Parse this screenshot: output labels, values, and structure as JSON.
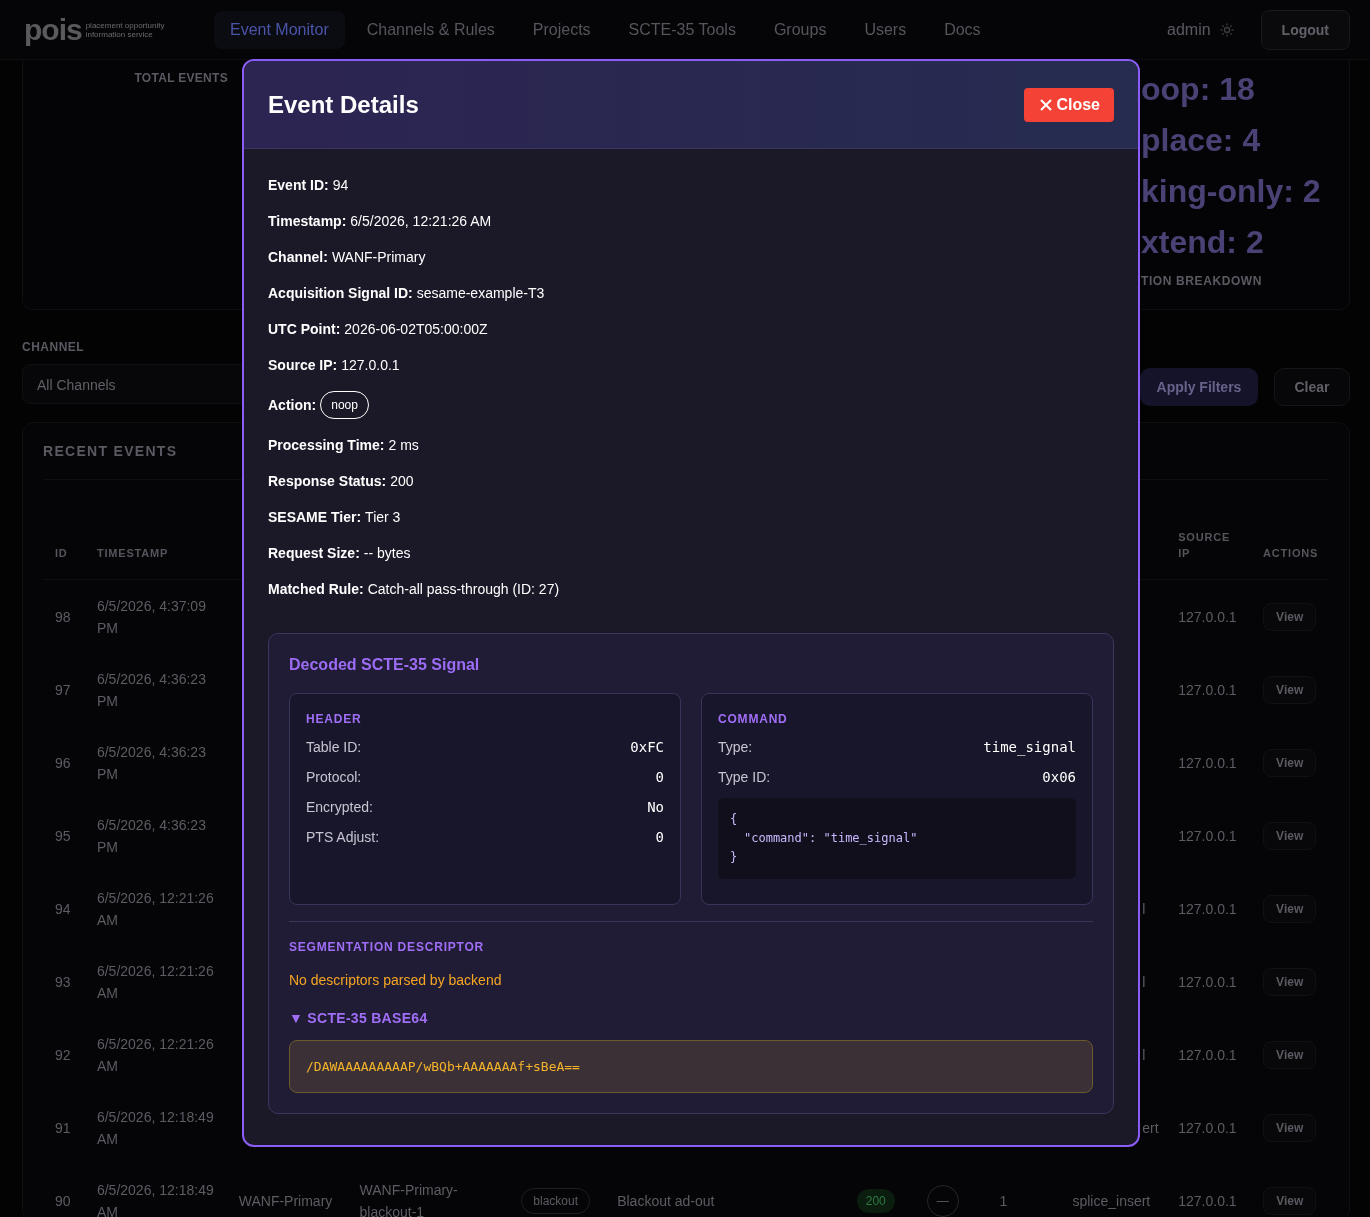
{
  "nav": {
    "logo": "pois",
    "tagline": "placement opportunity information service",
    "links": [
      {
        "label": "Event Monitor",
        "selected": true
      },
      {
        "label": "Channels & Rules",
        "selected": false
      },
      {
        "label": "Projects",
        "selected": false
      },
      {
        "label": "SCTE-35 Tools",
        "selected": false
      },
      {
        "label": "Groups",
        "selected": false
      },
      {
        "label": "Users",
        "selected": false
      },
      {
        "label": "Docs",
        "selected": false
      }
    ],
    "user": "admin",
    "logout": "Logout"
  },
  "stats": {
    "total_label": "TOTAL EVENTS",
    "breakdown": [
      "oop: 18",
      "place: 4",
      "king-only: 2",
      "xtend: 2"
    ],
    "breakdown_label": "TION BREAKDOWN"
  },
  "filters": {
    "channel_label": "CHANNEL",
    "channel_value": "All Channels",
    "apply": "Apply Filters",
    "clear": "Clear"
  },
  "events": {
    "title": "RECENT EVENTS",
    "columns": [
      "ID",
      "TIMESTAMP",
      "SOURCE IP",
      "ACTIONS"
    ],
    "rows": [
      {
        "id": "98",
        "timestamp": "6/5/2026, 4:37:09 PM",
        "source_ip": "127.0.0.1",
        "button": "View"
      },
      {
        "id": "97",
        "timestamp": "6/5/2026, 4:36:23 PM",
        "source_ip": "127.0.0.1",
        "button": "View"
      },
      {
        "id": "96",
        "timestamp": "6/5/2026, 4:36:23 PM",
        "source_ip": "127.0.0.1",
        "button": "View"
      },
      {
        "id": "95",
        "timestamp": "6/5/2026, 4:36:23 PM",
        "source_ip": "127.0.0.1",
        "button": "View"
      },
      {
        "id": "94",
        "timestamp": "6/5/2026, 12:21:26 AM",
        "command": "l",
        "source_ip": "127.0.0.1",
        "button": "View"
      },
      {
        "id": "93",
        "timestamp": "6/5/2026, 12:21:26 AM",
        "command": "l",
        "source_ip": "127.0.0.1",
        "button": "View"
      },
      {
        "id": "92",
        "timestamp": "6/5/2026, 12:21:26 AM",
        "command": "l",
        "source_ip": "127.0.0.1",
        "button": "View"
      },
      {
        "id": "91",
        "timestamp": "6/5/2026, 12:18:49 AM",
        "command": "ert",
        "source_ip": "127.0.0.1",
        "button": "View"
      },
      {
        "id": "90",
        "timestamp": "6/5/2026, 12:18:49 AM",
        "channel": "WANF-Primary",
        "signal": "WANF-Primary-blackout-1",
        "action": "blackout",
        "description": "Blackout ad-out",
        "status": "200",
        "processing": "—",
        "tier": "1",
        "command": "splice_insert",
        "source_ip": "127.0.0.1",
        "button": "View"
      }
    ]
  },
  "modal": {
    "title": "Event Details",
    "close": "Close",
    "fields": [
      {
        "label": "Event ID:",
        "value": "94"
      },
      {
        "label": "Timestamp:",
        "value": "6/5/2026, 12:21:26 AM"
      },
      {
        "label": "Channel:",
        "value": "WANF-Primary"
      },
      {
        "label": "Acquisition Signal ID:",
        "value": "sesame-example-T3"
      },
      {
        "label": "UTC Point:",
        "value": "2026-06-02T05:00:00Z"
      },
      {
        "label": "Source IP:",
        "value": "127.0.0.1"
      },
      {
        "label": "Action:",
        "value": "noop",
        "kind": "badge"
      },
      {
        "label": "Processing Time:",
        "value": "2 ms"
      },
      {
        "label": "Response Status:",
        "value": "200"
      },
      {
        "label": "SESAME Tier:",
        "value": "Tier 3"
      },
      {
        "label": "Request Size:",
        "value": "-- bytes"
      },
      {
        "label": "Matched Rule:",
        "value": "Catch-all pass-through (ID: 27)"
      }
    ],
    "decoded": {
      "title": "Decoded SCTE-35 Signal",
      "panels": [
        {
          "title": "HEADER",
          "rows": [
            {
              "label": "Table ID:",
              "value": "0xFC"
            },
            {
              "label": "Protocol:",
              "value": "0"
            },
            {
              "label": "Encrypted:",
              "value": "No"
            },
            {
              "label": "PTS Adjust:",
              "value": "0"
            }
          ]
        },
        {
          "title": "COMMAND",
          "rows": [
            {
              "label": "Type:",
              "value": "time_signal"
            },
            {
              "label": "Type ID:",
              "value": "0x06"
            }
          ],
          "code": [
            "{",
            "\"command\": \"time_signal\"",
            "}"
          ]
        }
      ],
      "segmentation": {
        "title": "SEGMENTATION DESCRIPTOR",
        "message": "No descriptors parsed by backend"
      },
      "base64": {
        "toggle": "▼",
        "label": "SCTE-35 BASE64",
        "expanded": true,
        "value": "/DAWAAAAAAAAAP/wBQb+AAAAAAAf+sBeA=="
      }
    }
  }
}
